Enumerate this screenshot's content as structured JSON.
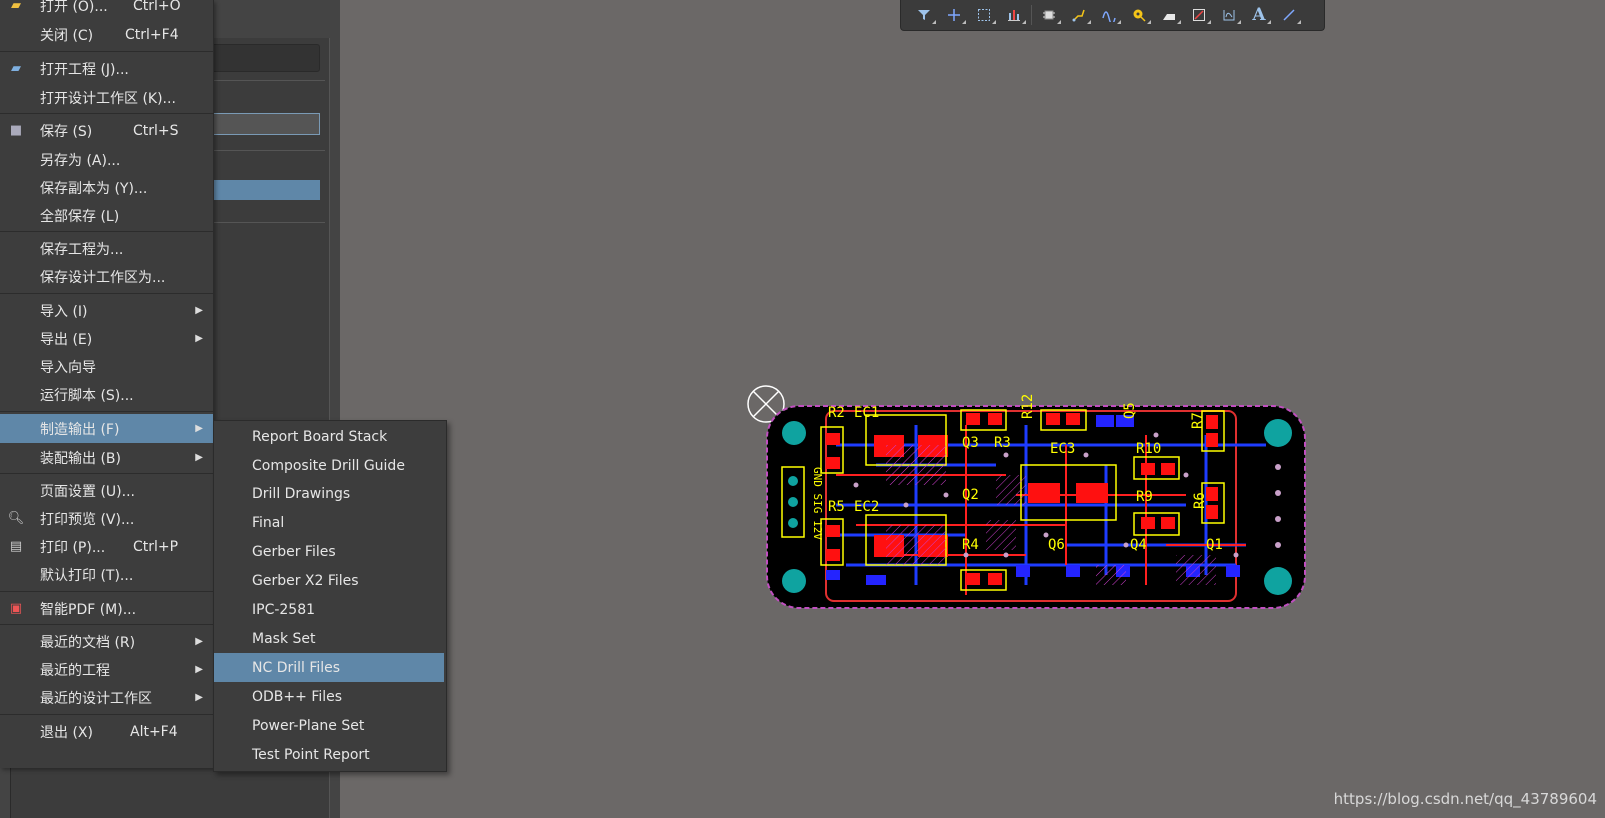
{
  "toolbar": {
    "icons": [
      "filter-icon",
      "cross-icon",
      "select-rect-icon",
      "bar-chart-icon",
      "component-icon",
      "route-icon",
      "interactive-route-icon",
      "via-icon",
      "fill-icon",
      "rectangle-icon",
      "dimension-icon",
      "text-icon",
      "line-icon"
    ]
  },
  "file_menu": [
    {
      "label": "打开 (O)...",
      "shortcut": "Ctrl+O",
      "icon": "folder-open-icon"
    },
    {
      "label": "关闭 (C)",
      "shortcut": "Ctrl+F4"
    },
    {
      "label": "打开工程 (J)...",
      "icon": "project-open-icon"
    },
    {
      "label": "打开设计工作区 (K)..."
    },
    {
      "label": "保存 (S)",
      "shortcut": "Ctrl+S",
      "icon": "save-icon"
    },
    {
      "label": "另存为 (A)..."
    },
    {
      "label": "保存副本为 (Y)..."
    },
    {
      "label": "全部保存 (L)"
    },
    {
      "label": "保存工程为..."
    },
    {
      "label": "保存设计工作区为..."
    },
    {
      "label": "导入 (I)",
      "submenu": true
    },
    {
      "label": "导出 (E)",
      "submenu": true
    },
    {
      "label": "导入向导"
    },
    {
      "label": "运行脚本 (S)..."
    },
    {
      "label": "制造输出 (F)",
      "submenu": true,
      "active": true
    },
    {
      "label": "装配输出 (B)",
      "submenu": true
    },
    {
      "label": "页面设置 (U)..."
    },
    {
      "label": "打印预览 (V)...",
      "icon": "print-preview-icon"
    },
    {
      "label": "打印 (P)...",
      "shortcut": "Ctrl+P",
      "icon": "print-icon"
    },
    {
      "label": "默认打印 (T)..."
    },
    {
      "label": "智能PDF (M)...",
      "icon": "pdf-icon"
    },
    {
      "label": "最近的文档 (R)",
      "submenu": true
    },
    {
      "label": "最近的工程",
      "submenu": true
    },
    {
      "label": "最近的设计工作区",
      "submenu": true
    },
    {
      "label": "退出 (X)",
      "shortcut": "Alt+F4"
    }
  ],
  "fab_submenu": [
    {
      "label": "Report Board Stack"
    },
    {
      "label": "Composite Drill Guide"
    },
    {
      "label": "Drill Drawings"
    },
    {
      "label": "Final"
    },
    {
      "label": "Gerber Files"
    },
    {
      "label": "Gerber X2 Files"
    },
    {
      "label": "IPC-2581"
    },
    {
      "label": "Mask Set"
    },
    {
      "label": "NC Drill Files",
      "active": true
    },
    {
      "label": "ODB++ Files"
    },
    {
      "label": "Power-Plane Set"
    },
    {
      "label": "Test Point Report"
    }
  ],
  "pcb": {
    "designators": [
      "R2",
      "EC1",
      "Q3",
      "R3",
      "R12",
      "Q5",
      "R7",
      "EC3",
      "R10",
      "R9",
      "R6",
      "R5",
      "EC2",
      "Q2",
      "R4",
      "Q6",
      "Q4",
      "Q1"
    ],
    "connector_labels": [
      "GND",
      "SIG",
      "12V"
    ]
  },
  "colors": {
    "menu_bg": "#3d3d3d",
    "highlight": "#5f87a8",
    "canvas": "#6b6867",
    "board": "#000000",
    "copper_top": "#ff0000",
    "copper_bottom": "#0000ff",
    "silkscreen": "#ffff00"
  },
  "watermark": "https://blog.csdn.net/qq_43789604"
}
